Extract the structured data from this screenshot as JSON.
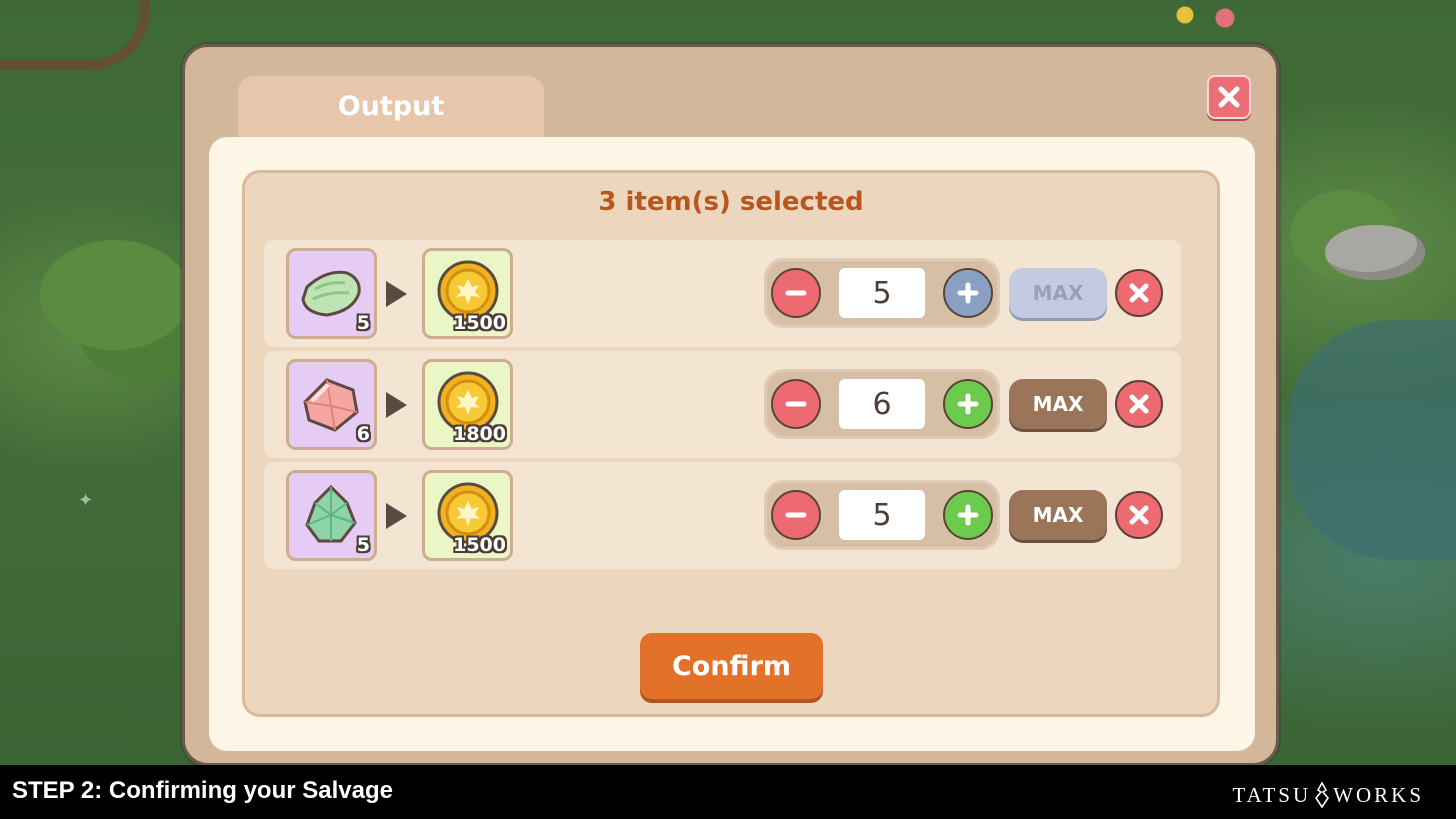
{
  "modal": {
    "tab_label": "Output",
    "selected_text": "3 item(s) selected",
    "confirm_label": "Confirm",
    "rows": [
      {
        "input_icon": "cloth-icon",
        "input_count": "5",
        "output_icon": "gold-coin-icon",
        "output_amount": "1500",
        "quantity": "5",
        "max_label": "MAX",
        "max_disabled": true,
        "plus_disabled": true
      },
      {
        "input_icon": "pink-gem-icon",
        "input_count": "6",
        "output_icon": "gold-coin-icon",
        "output_amount": "1800",
        "quantity": "6",
        "max_label": "MAX",
        "max_disabled": false,
        "plus_disabled": false
      },
      {
        "input_icon": "green-crystal-icon",
        "input_count": "5",
        "output_icon": "gold-coin-icon",
        "output_amount": "1500",
        "quantity": "5",
        "max_label": "MAX",
        "max_disabled": false,
        "plus_disabled": false
      }
    ]
  },
  "caption": "STEP 2: Confirming your Salvage",
  "brand": {
    "left": "TATSU",
    "right": "WORKS"
  },
  "colors": {
    "accent": "#e2722a",
    "title": "#b8561e",
    "danger": "#ec6a70",
    "positive": "#6ccb4d",
    "disabled": "#c3cbe0"
  }
}
